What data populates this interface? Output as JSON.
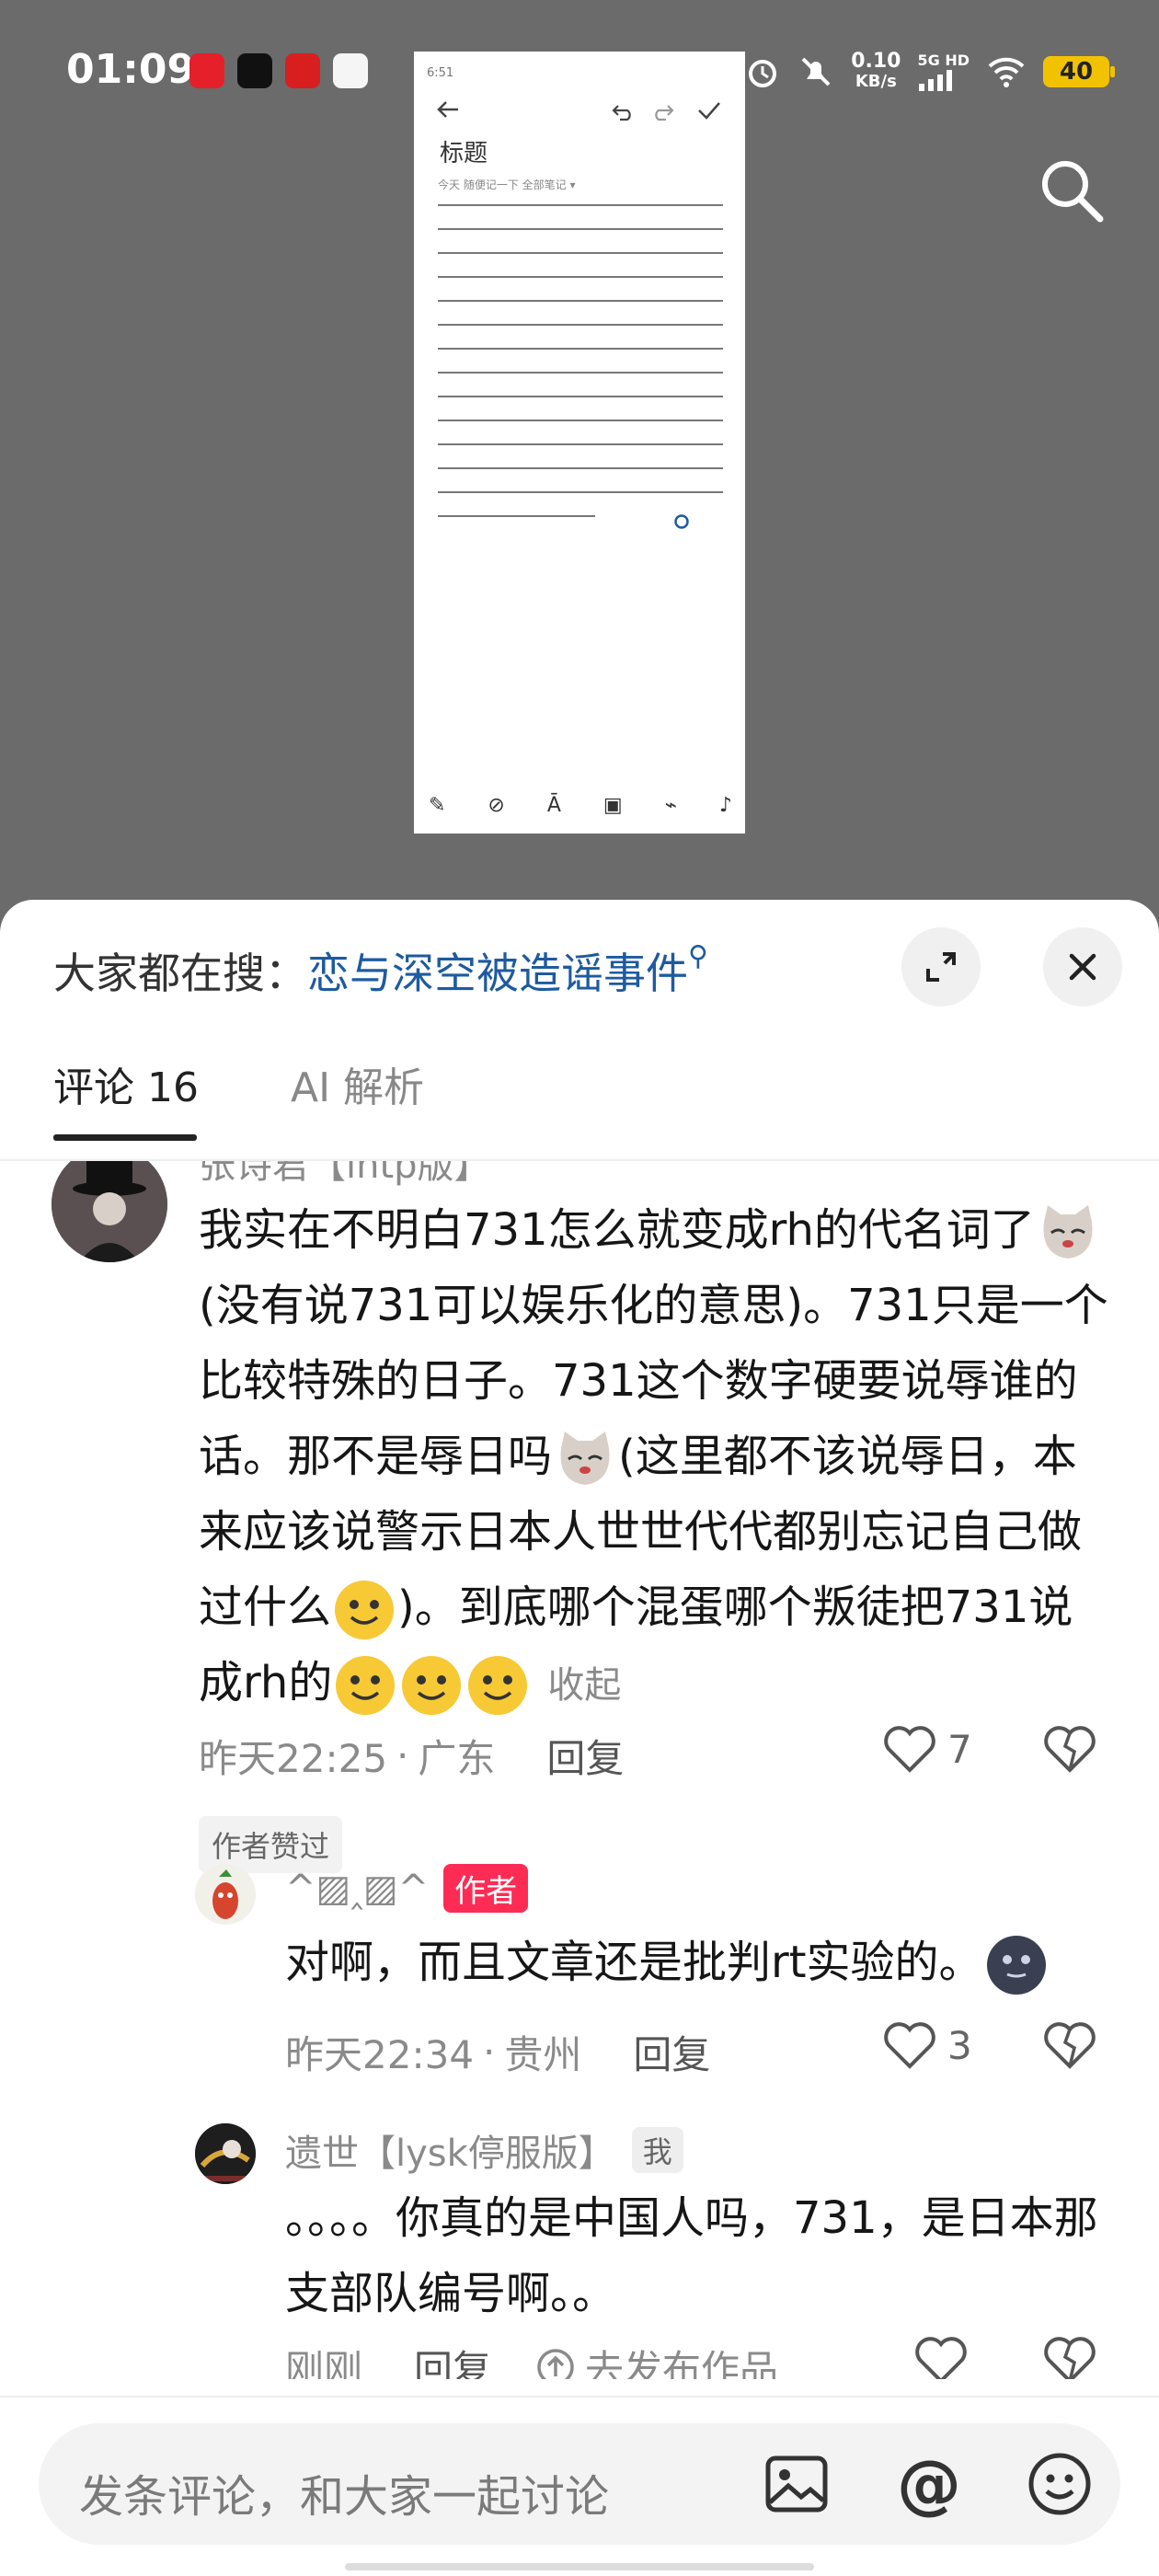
{
  "status": {
    "time": "01:09",
    "net_speed": "0.10",
    "net_unit": "KB/s",
    "network": "5G HD",
    "battery": "40"
  },
  "preview": {
    "status": "6:51",
    "title": "标题",
    "meta": "今天 随便记一下   全部笔记 ▾",
    "line_count": 14
  },
  "sheet": {
    "everyone_label": "大家都在搜：",
    "search_topic": "恋与深空被造谣事件",
    "tabs": [
      {
        "label": "评论 16",
        "active": true
      },
      {
        "label": "AI 解析",
        "active": false
      }
    ]
  },
  "comments": [
    {
      "user": "张诗君【lntp版】",
      "text_parts": [
        "我实在不明白731怎么就变成rh的代名词了",
        "(没有说731可以娱乐化的意思)。731只是一个比较特殊的日子。731这个数字硬要说辱谁的话。那不是辱日吗",
        "(这里都不该说辱日，本来应该说警示日本人世世代代都别忘记自己做过什么",
        ")。到底哪个混蛋哪个叛徒把731说成rh的"
      ],
      "collapse": "收起",
      "time": "昨天22:25",
      "location": "广东",
      "reply": "回复",
      "likes": "7",
      "chip": "作者赞过"
    },
    {
      "user": "^▨‸▨^",
      "author_tag": "作者",
      "text": "对啊，而且文章还是批判rt实验的。",
      "time": "昨天22:34",
      "location": "贵州",
      "reply": "回复",
      "likes": "3"
    },
    {
      "user": "遗世【lysk停服版】",
      "me_tag": "我",
      "text": "。。。。你真的是中国人吗，731，是日本那支部队编号啊。。",
      "time": "刚刚",
      "reply": "回复",
      "publish": "去发布作品"
    }
  ],
  "input": {
    "placeholder": "发条评论，和大家一起讨论"
  }
}
